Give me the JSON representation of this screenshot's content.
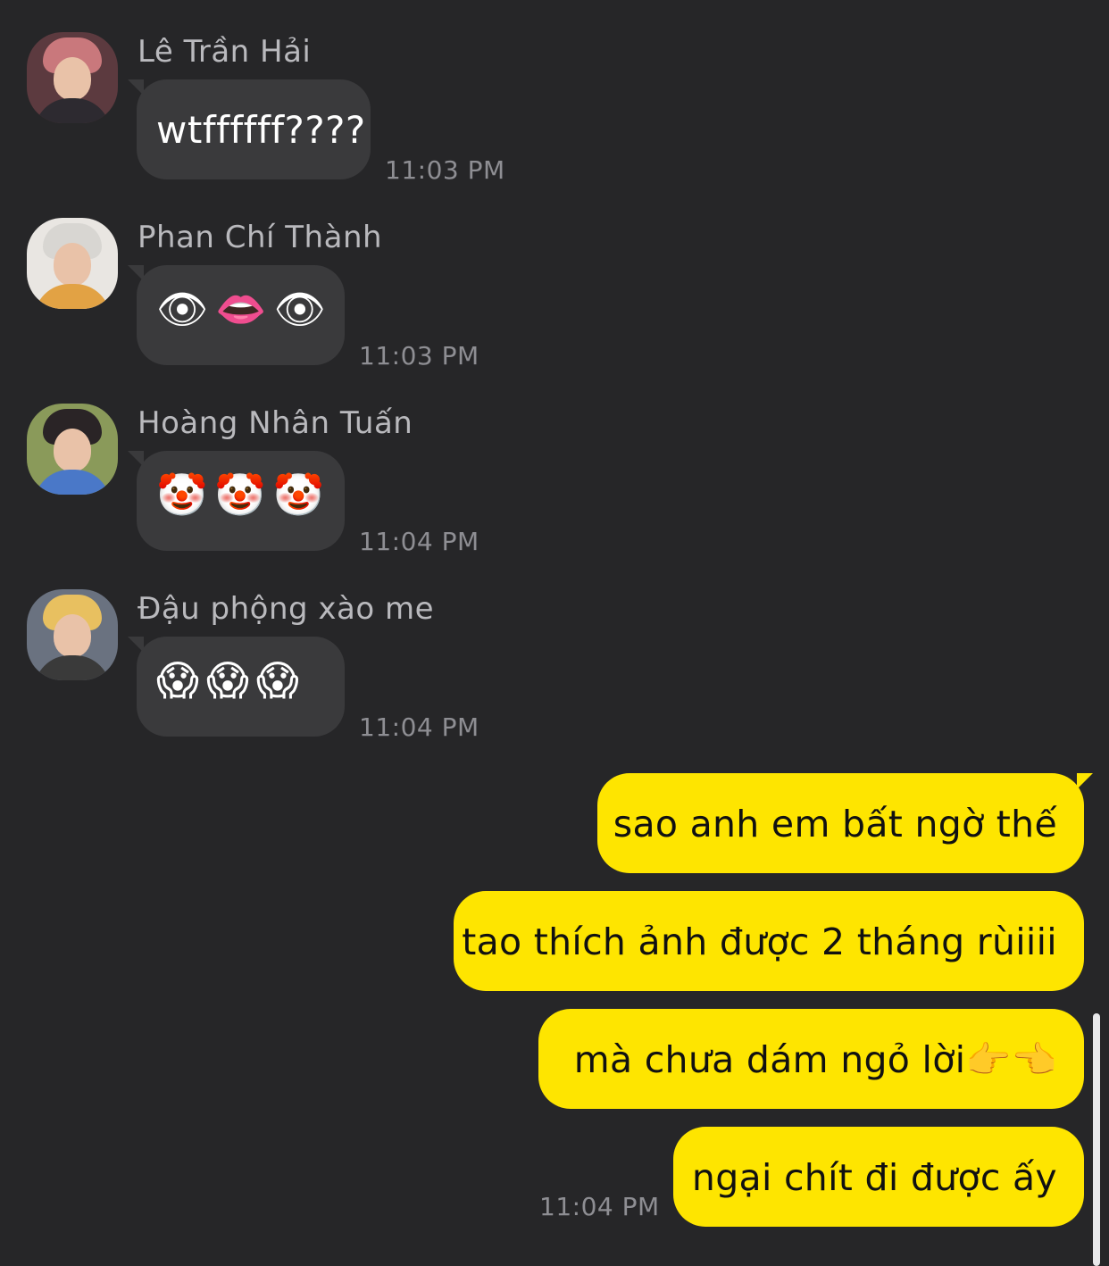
{
  "messages_in": [
    {
      "sender": "Lê Trần Hải",
      "text": "wtffffff????",
      "time": "11:03 PM",
      "avatar_colors": {
        "bg": "#5c3a3f",
        "hair": "#c9787c",
        "body": "#2d2a30"
      }
    },
    {
      "sender": "Phan Chí Thành",
      "text": "👁👄👁",
      "time": "11:03 PM",
      "avatar_colors": {
        "bg": "#e9e6e2",
        "hair": "#d8d6d2",
        "body": "#e2a244"
      }
    },
    {
      "sender": "Hoàng Nhân Tuấn",
      "text": "🤡🤡🤡",
      "time": "11:04 PM",
      "avatar_colors": {
        "bg": "#8a9a5a",
        "hair": "#2a2426",
        "body": "#4a78c8"
      }
    },
    {
      "sender": "Đậu phộng xào me",
      "text": "😱😱😱",
      "time": "11:04 PM",
      "avatar_colors": {
        "bg": "#6a7280",
        "hair": "#e8c060",
        "body": "#3a3a3a"
      }
    }
  ],
  "messages_out": [
    {
      "text": "sao anh em bất ngờ thế"
    },
    {
      "text": "tao thích ảnh được 2 tháng rùiiii"
    },
    {
      "text": "mà chưa dám ngỏ lời👉👈"
    },
    {
      "text": "ngại chít đi được ấy"
    }
  ],
  "messages_out_time": "11:04 PM",
  "colors": {
    "background": "#262628",
    "incoming_bubble": "#3a3a3c",
    "outgoing_bubble": "#fee500"
  }
}
